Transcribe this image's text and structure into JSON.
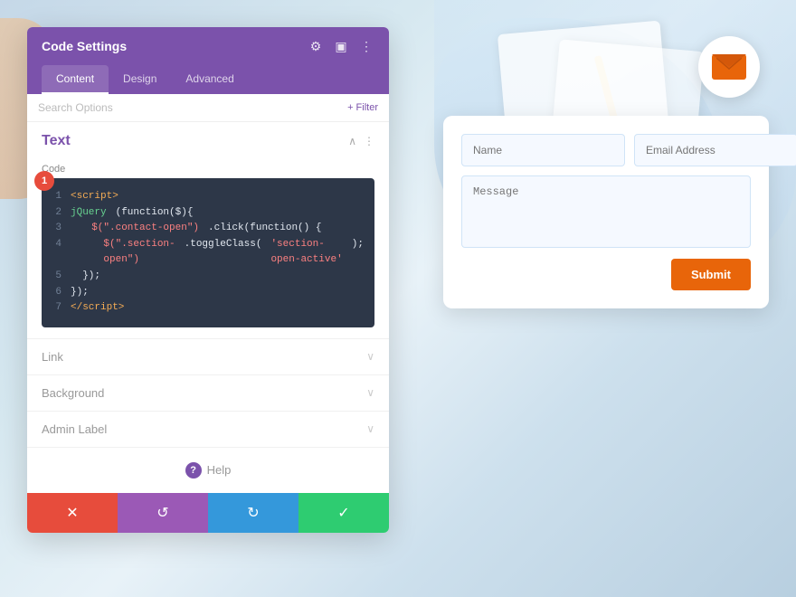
{
  "background": {
    "color_start": "#c5d8e8",
    "color_end": "#d6e8f0"
  },
  "panel": {
    "title": "Code Settings",
    "tabs": [
      {
        "label": "Content",
        "active": true
      },
      {
        "label": "Design",
        "active": false
      },
      {
        "label": "Advanced",
        "active": false
      }
    ],
    "search_placeholder": "Search Options",
    "filter_label": "+ Filter",
    "sections": {
      "text": {
        "title": "Text",
        "code_label": "Code",
        "step_badge": "1",
        "code_lines": [
          {
            "num": "1",
            "content": "<script>"
          },
          {
            "num": "2",
            "content": "jQuery(function($){"
          },
          {
            "num": "3",
            "content": "  $(\".contact-open\").click(function() {"
          },
          {
            "num": "4",
            "content": "    $(\".section-open\").toggleClass('section-open-active');"
          },
          {
            "num": "5",
            "content": "  });"
          },
          {
            "num": "6",
            "content": "});"
          },
          {
            "num": "7",
            "content": "</script>"
          }
        ]
      },
      "link": {
        "label": "Link"
      },
      "background": {
        "label": "Background"
      },
      "admin_label": {
        "label": "Admin Label"
      }
    },
    "help_label": "Help",
    "actions": {
      "cancel": "✕",
      "reset": "↺",
      "redo": "↻",
      "confirm": "✓"
    }
  },
  "email_fab": {
    "aria_label": "Email"
  },
  "contact_form": {
    "name_placeholder": "Name",
    "email_placeholder": "Email Address",
    "message_placeholder": "Message",
    "submit_label": "Submit"
  }
}
